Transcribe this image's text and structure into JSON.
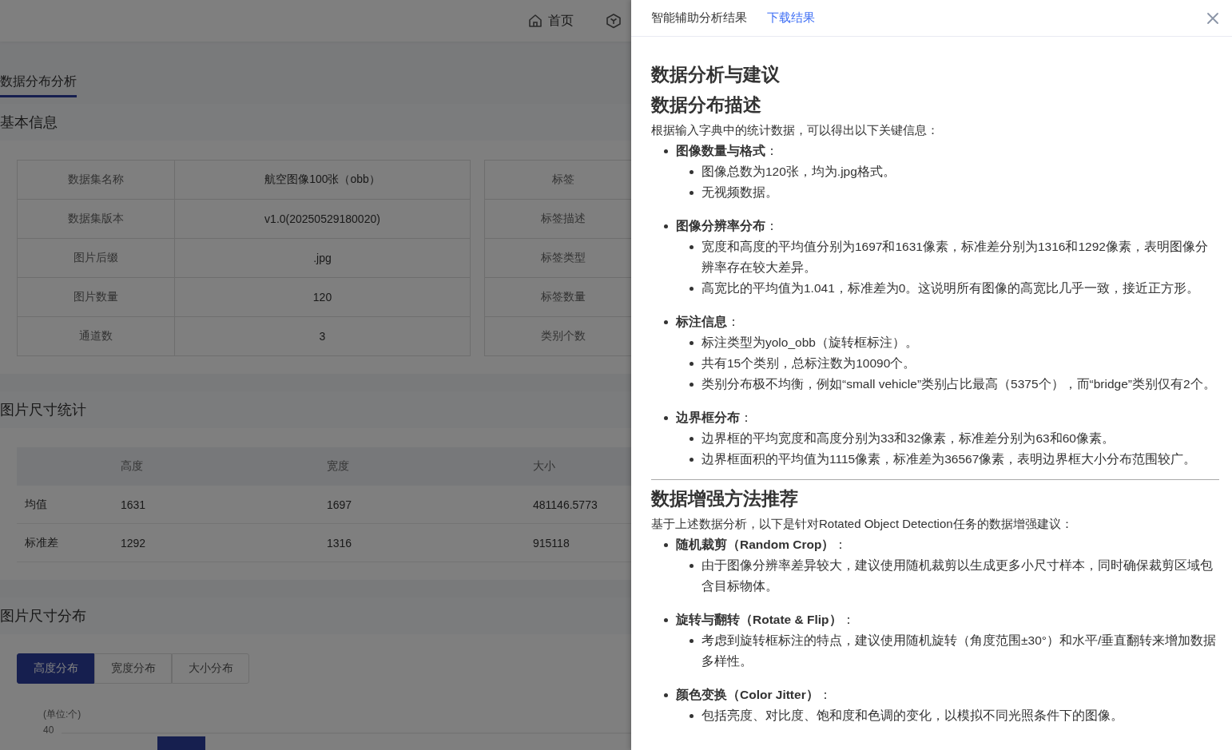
{
  "nav": [
    {
      "kind": "home",
      "label": "首页"
    },
    {
      "kind": "cube"
    }
  ],
  "tabs": [
    {
      "label": "数据分布分析",
      "selected": true
    }
  ],
  "basic_info": {
    "title": "基本信息",
    "rows": [
      {
        "label": "数据集名称",
        "value": "航空图像100张（obb）"
      },
      {
        "label": "数据集版本",
        "value": "v1.0(20250529180020)"
      },
      {
        "label": "图片后缀",
        "value": ".jpg"
      },
      {
        "label": "图片数量",
        "value": "120"
      },
      {
        "label": "通道数",
        "value": "3"
      }
    ],
    "label_rows": [
      "标签",
      "标签描述",
      "标签类型",
      "标签数量",
      "类别个数"
    ]
  },
  "size_stats": {
    "title": "图片尺寸统计",
    "columns": [
      "高度",
      "宽度",
      "大小"
    ],
    "rows": [
      {
        "label": "均值",
        "values": [
          "1631",
          "1697",
          "481146.5773"
        ]
      },
      {
        "label": "标准差",
        "values": [
          "1292",
          "1316",
          "915118"
        ]
      }
    ]
  },
  "size_dist": {
    "title": "图片尺寸分布",
    "tabs": [
      {
        "label": "高度分布",
        "selected": true
      },
      {
        "label": "宽度分布",
        "selected": false
      },
      {
        "label": "大小分布",
        "selected": false
      }
    ],
    "unit": "(单位:个)",
    "tick": "40"
  },
  "report": {
    "title": "智能辅助分析结果",
    "download": "下载结果",
    "blocks": [
      {
        "kind": "h1",
        "text": "数据分析与建议"
      },
      {
        "kind": "h2",
        "text": "数据分布描述"
      },
      {
        "kind": "p",
        "text": "根据输入字典中的统计数据，可以得出以下关键信息："
      },
      {
        "kind": "list",
        "items": [
          {
            "text": "**图像数量与格式**：",
            "children": [
              {
                "text": "图像总数为120张，均为.jpg格式。"
              },
              {
                "text": "无视频数据。"
              }
            ]
          },
          {
            "text": "**图像分辨率分布**：",
            "children": [
              {
                "text": "宽度和高度的平均值分别为1697和1631像素，标准差分别为1316和1292像素，表明图像分辨率存在较大差异。"
              },
              {
                "text": "高宽比的平均值为1.041，标准差为0。这说明所有图像的高宽比几乎一致，接近正方形。"
              }
            ]
          },
          {
            "text": "**标注信息**：",
            "children": [
              {
                "text": "标注类型为yolo_obb（旋转框标注）。"
              },
              {
                "text": "共有15个类别，总标注数为10090个。"
              },
              {
                "text": "类别分布极不均衡，例如“small vehicle”类别占比最高（5375个），而“bridge”类别仅有2个。"
              }
            ]
          },
          {
            "text": "**边界框分布**：",
            "children": [
              {
                "text": "边界框的平均宽度和高度分别为33和32像素，标准差分别为63和60像素。"
              },
              {
                "text": "边界框面积的平均值为1115像素，标准差为36567像素，表明边界框大小分布范围较广。"
              }
            ]
          }
        ]
      },
      {
        "kind": "hr"
      },
      {
        "kind": "h2",
        "text": "数据增强方法推荐"
      },
      {
        "kind": "p",
        "text": "基于上述数据分析，以下是针对Rotated Object Detection任务的数据增强建议："
      },
      {
        "kind": "list",
        "items": [
          {
            "text": "**随机裁剪（Random Crop）**：",
            "children": [
              {
                "text": "由于图像分辨率差异较大，建议使用随机裁剪以生成更多小尺寸样本，同时确保裁剪区域包含目标物体。"
              }
            ]
          },
          {
            "text": "**旋转与翻转（Rotate & Flip）**：",
            "children": [
              {
                "text": "考虑到旋转框标注的特点，建议使用随机旋转（角度范围±30°）和水平/垂直翻转来增加数据多样性。"
              }
            ]
          },
          {
            "text": "**颜色变换（Color Jitter）**：",
            "children": [
              {
                "text": "包括亮度、对比度、饱和度和色调的变化，以模拟不同光照条件下的图像。"
              }
            ]
          }
        ]
      }
    ]
  }
}
